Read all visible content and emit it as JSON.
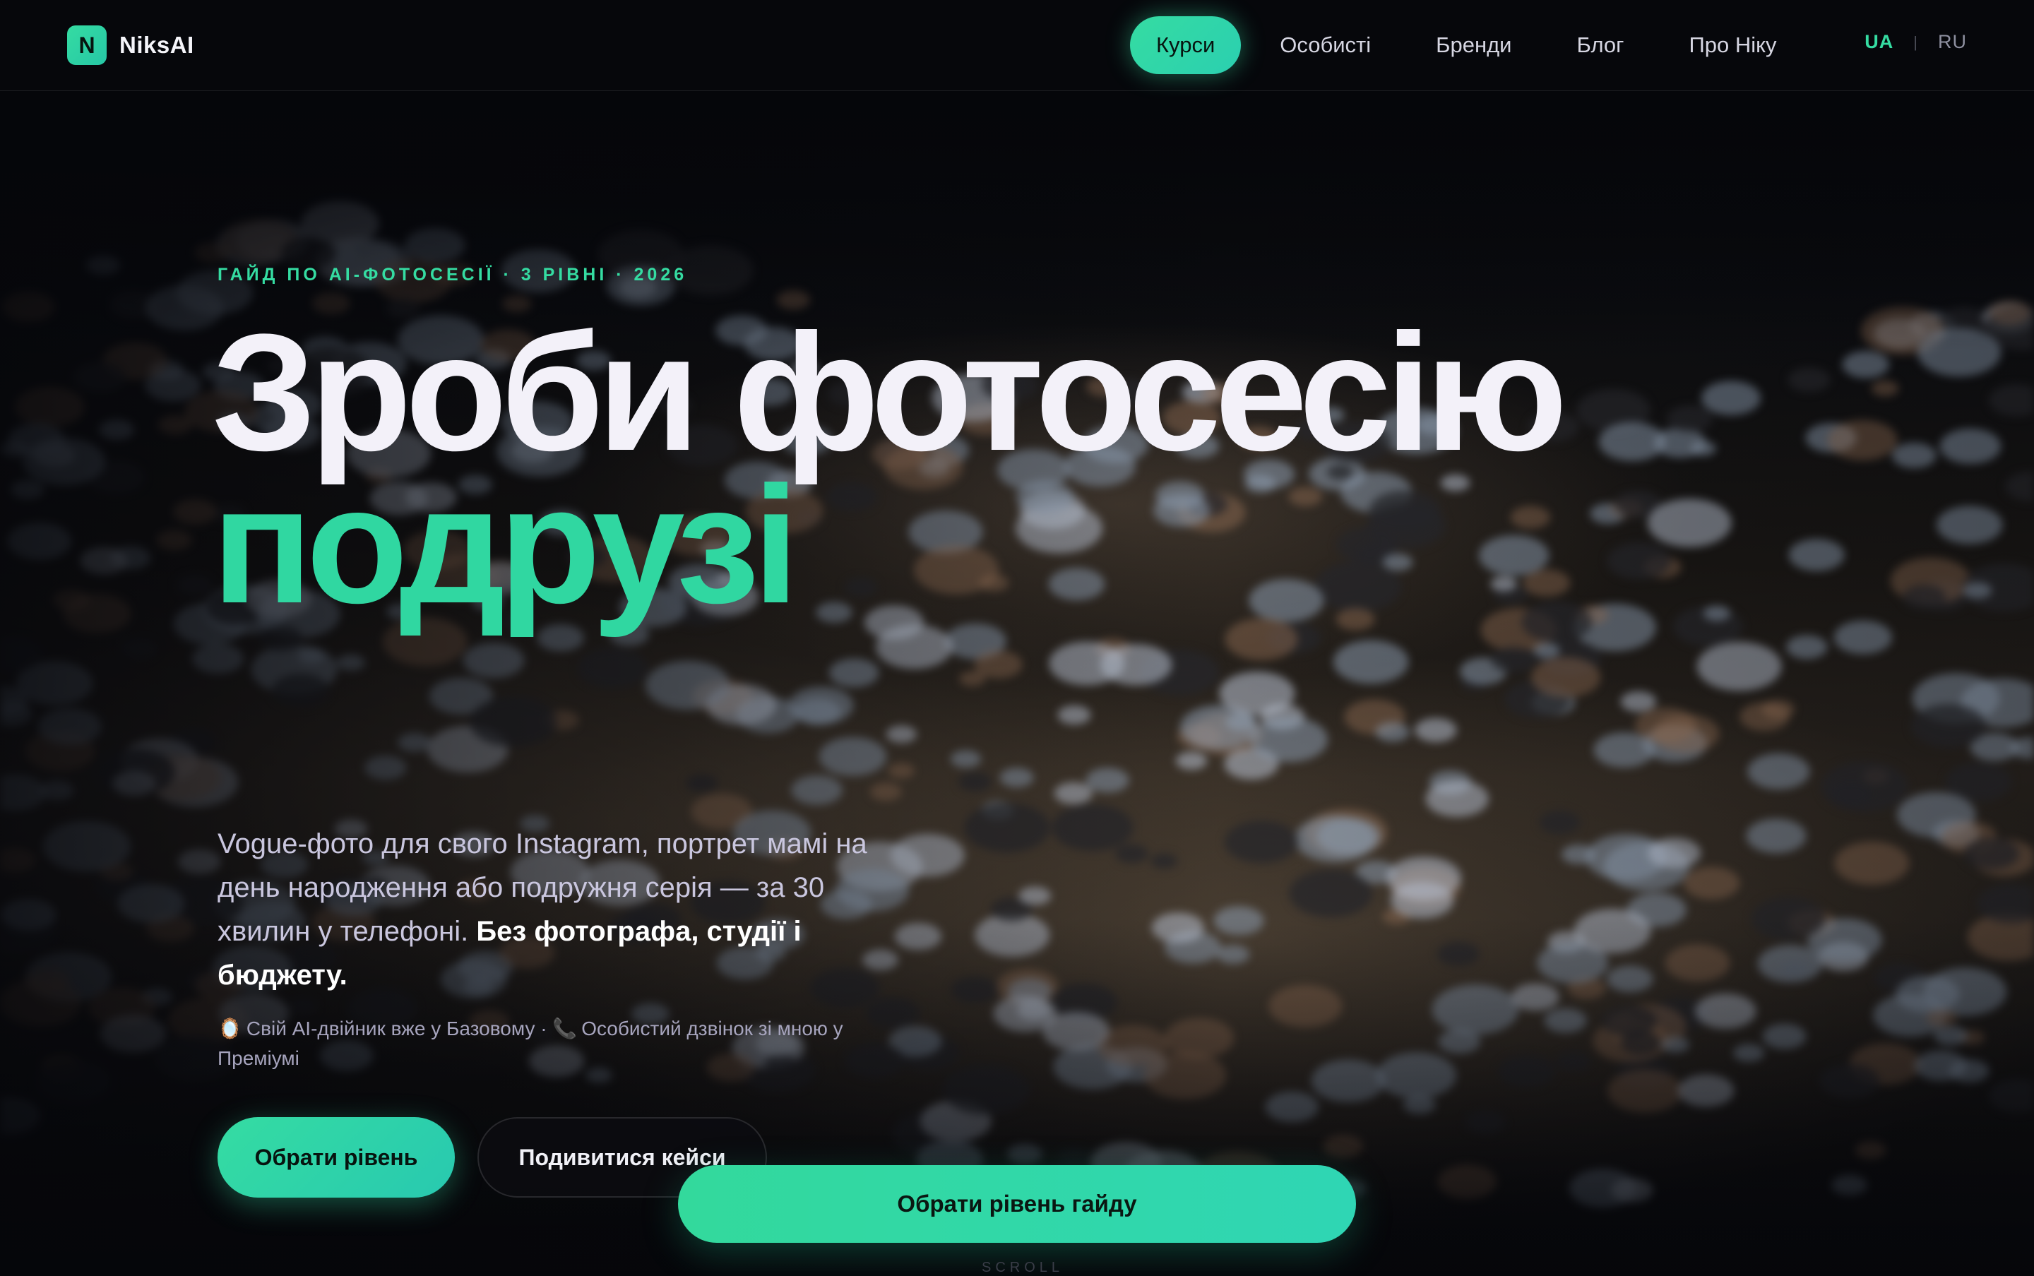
{
  "brand": {
    "logo_letter": "N",
    "name": "NiksAI"
  },
  "nav": {
    "items": [
      {
        "label": "Курси",
        "active": true
      },
      {
        "label": "Особисті",
        "active": false
      },
      {
        "label": "Бренди",
        "active": false
      },
      {
        "label": "Блог",
        "active": false
      },
      {
        "label": "Про Ніку",
        "active": false
      }
    ]
  },
  "lang": {
    "current": "UA",
    "separator": "|",
    "other": "RU"
  },
  "hero": {
    "eyebrow": "ГАЙД ПО AI-ФОТОСЕСІЇ · 3 РІВНІ · 2026",
    "title_line1": "Зроби фотосесію",
    "title_line2": "подрузі",
    "lead_text": "Vogue-фото для свого Instagram, портрет мамі на день народження або подружня серія — за 30 хвилин у телефоні. ",
    "lead_bold": "Без фотографа, студії і бюджету.",
    "note_part1": "Свій AI-двійник вже у Базовому · ",
    "note_part2": "Особистий дзвінок зі мною у Преміумі",
    "note_icon1": "mirror-icon",
    "note_icon2": "phone-icon",
    "primary_button": "Обрати рівень",
    "secondary_button": "Подивитися кейси"
  },
  "sticky_cta": {
    "label": "Обрати рівень гайду"
  },
  "scroll_hint": "SCROLL",
  "colors": {
    "accent": "#35dca2",
    "accent_alt": "#2bcfb0",
    "background": "#05060a",
    "title_white": "#f3f1f9",
    "muted_text": "#c9c6de"
  }
}
